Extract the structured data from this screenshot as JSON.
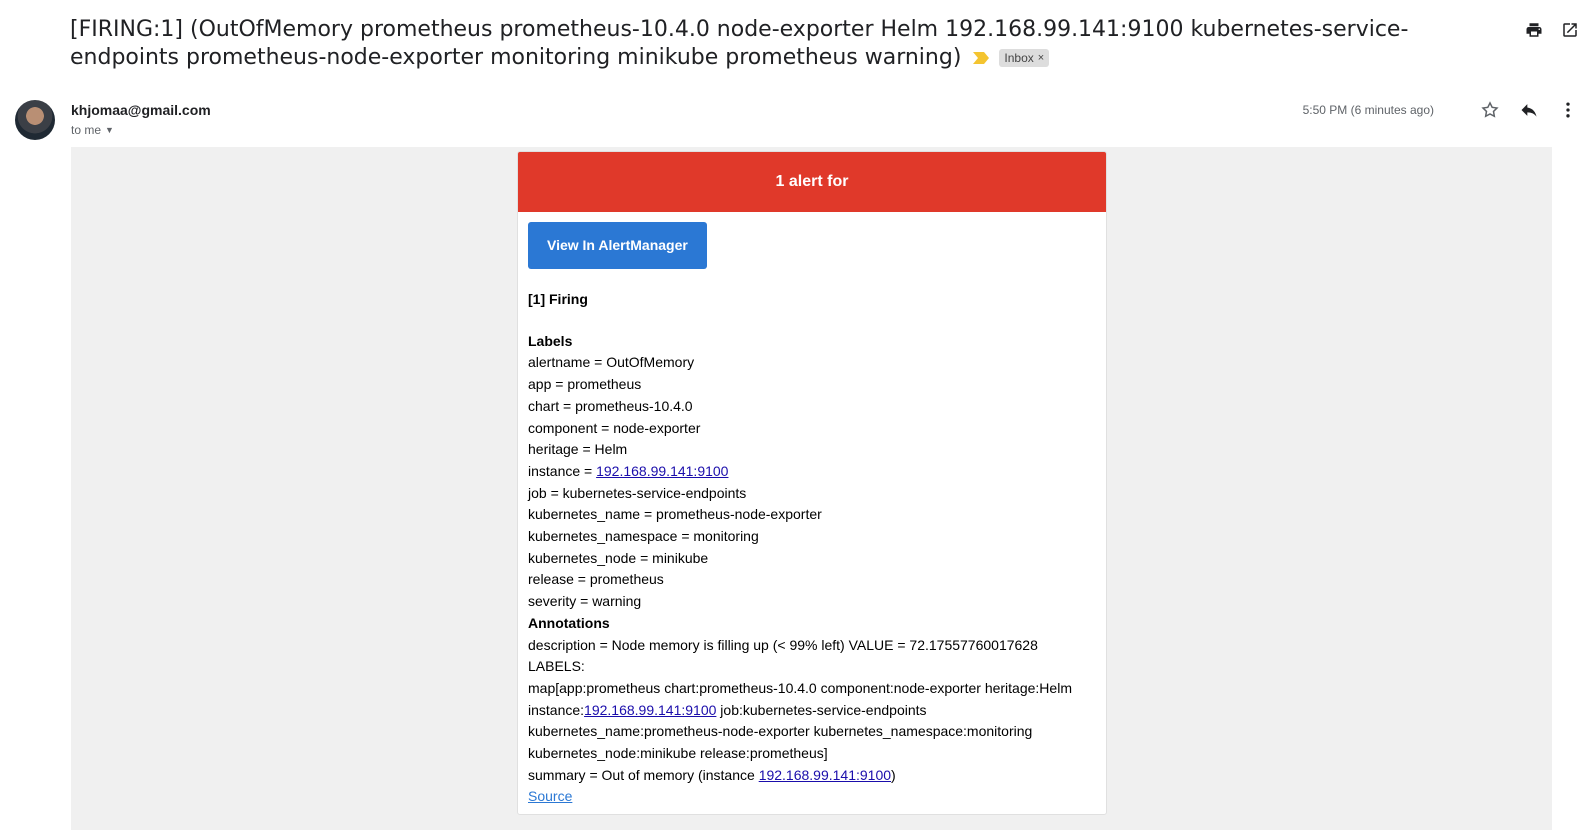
{
  "subject": {
    "text": "[FIRING:1] (OutOfMemory prometheus prometheus-10.4.0 node-exporter Helm 192.168.99.141:9100 kubernetes-service-endpoints prometheus-node-exporter monitoring minikube prometheus warning)",
    "label": "Inbox",
    "label_close": "×"
  },
  "toolbar": {
    "print_icon": "print-icon",
    "popout_icon": "open-in-new-window-icon"
  },
  "message": {
    "sender": "khjomaa@gmail.com",
    "to": "to me",
    "time": "5:50 PM (6 minutes ago)",
    "icons": [
      "star-icon",
      "reply-icon",
      "more-vert-icon"
    ]
  },
  "alert": {
    "banner": "1 alert for",
    "banner_color": "#e0392a",
    "button": "View In AlertManager",
    "button_color": "#2b78d4",
    "firing": "[1] Firing",
    "labels_title": "Labels",
    "labels": {
      "alertname": "alertname = OutOfMemory",
      "app": "app = prometheus",
      "chart": "chart = prometheus-10.4.0",
      "component": "component = node-exporter",
      "heritage": "heritage = Helm",
      "instance_prefix": "instance = ",
      "instance_link": "192.168.99.141:9100",
      "job": "job = kubernetes-service-endpoints",
      "kubernetes_name": "kubernetes_name = prometheus-node-exporter",
      "kubernetes_namespace": "kubernetes_namespace = monitoring",
      "kubernetes_node": "kubernetes_node = minikube",
      "release": "release = prometheus",
      "severity": "severity = warning"
    },
    "annotations_title": "Annotations",
    "description": {
      "line1": "description = Node memory is filling up (< 99% left) VALUE = 72.17557760017628 LABELS:",
      "line2": "map[app:prometheus chart:prometheus-10.4.0 component:node-exporter heritage:Helm",
      "line3_prefix": "instance:",
      "line3_link": "192.168.99.141:9100",
      "line3_suffix": " job:kubernetes-service-endpoints",
      "line4": "kubernetes_name:prometheus-node-exporter kubernetes_namespace:monitoring",
      "line5": "kubernetes_node:minikube release:prometheus]"
    },
    "summary": {
      "prefix": "summary = Out of memory (instance ",
      "link": "192.168.99.141:9100",
      "suffix": ")"
    },
    "source": "Source"
  }
}
